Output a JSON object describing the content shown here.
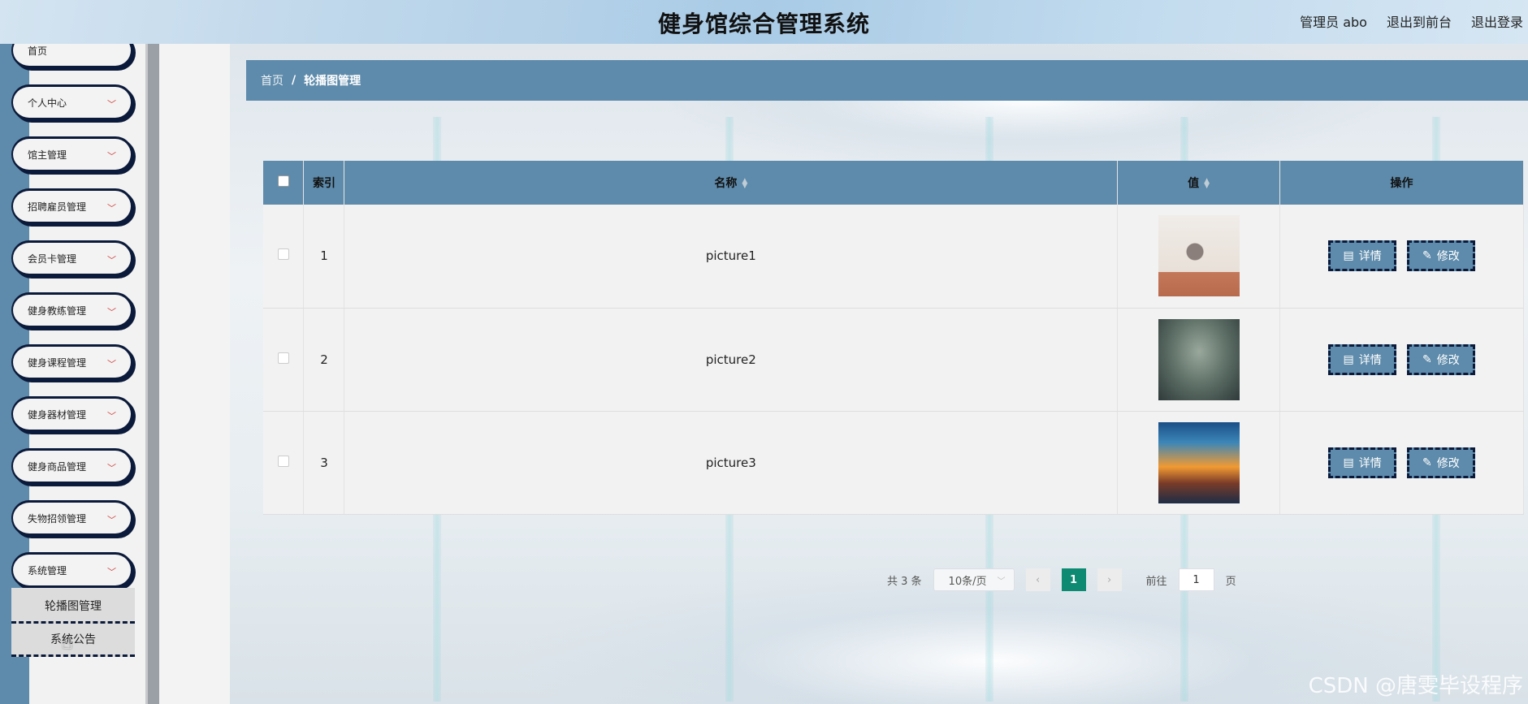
{
  "header": {
    "title": "健身馆综合管理系统",
    "user": "管理员 abo",
    "to_front": "退出到前台",
    "logout": "退出登录"
  },
  "sidebar": {
    "items": [
      {
        "label": "首页"
      },
      {
        "label": "个人中心"
      },
      {
        "label": "馆主管理"
      },
      {
        "label": "招聘雇员管理"
      },
      {
        "label": "会员卡管理"
      },
      {
        "label": "健身教练管理"
      },
      {
        "label": "健身课程管理"
      },
      {
        "label": "健身器材管理"
      },
      {
        "label": "健身商品管理"
      },
      {
        "label": "失物招领管理"
      },
      {
        "label": "系统管理"
      }
    ],
    "subitems": [
      {
        "label": "轮播图管理"
      },
      {
        "label": "系统公告"
      }
    ]
  },
  "breadcrumb": {
    "home": "首页",
    "separator": "/",
    "current": "轮播图管理"
  },
  "table": {
    "headers": {
      "index": "索引",
      "name": "名称",
      "value": "值",
      "actions": "操作"
    },
    "rows": [
      {
        "index": "1",
        "name": "picture1"
      },
      {
        "index": "2",
        "name": "picture2"
      },
      {
        "index": "3",
        "name": "picture3"
      }
    ],
    "detail_label": "详情",
    "edit_label": "修改"
  },
  "pagination": {
    "total": "共 3 条",
    "page_size": "10条/页",
    "current_page": "1",
    "goto_prefix": "前往",
    "goto_value": "1",
    "goto_suffix": "页"
  },
  "watermark": "CSDN @唐雯毕设程序"
}
